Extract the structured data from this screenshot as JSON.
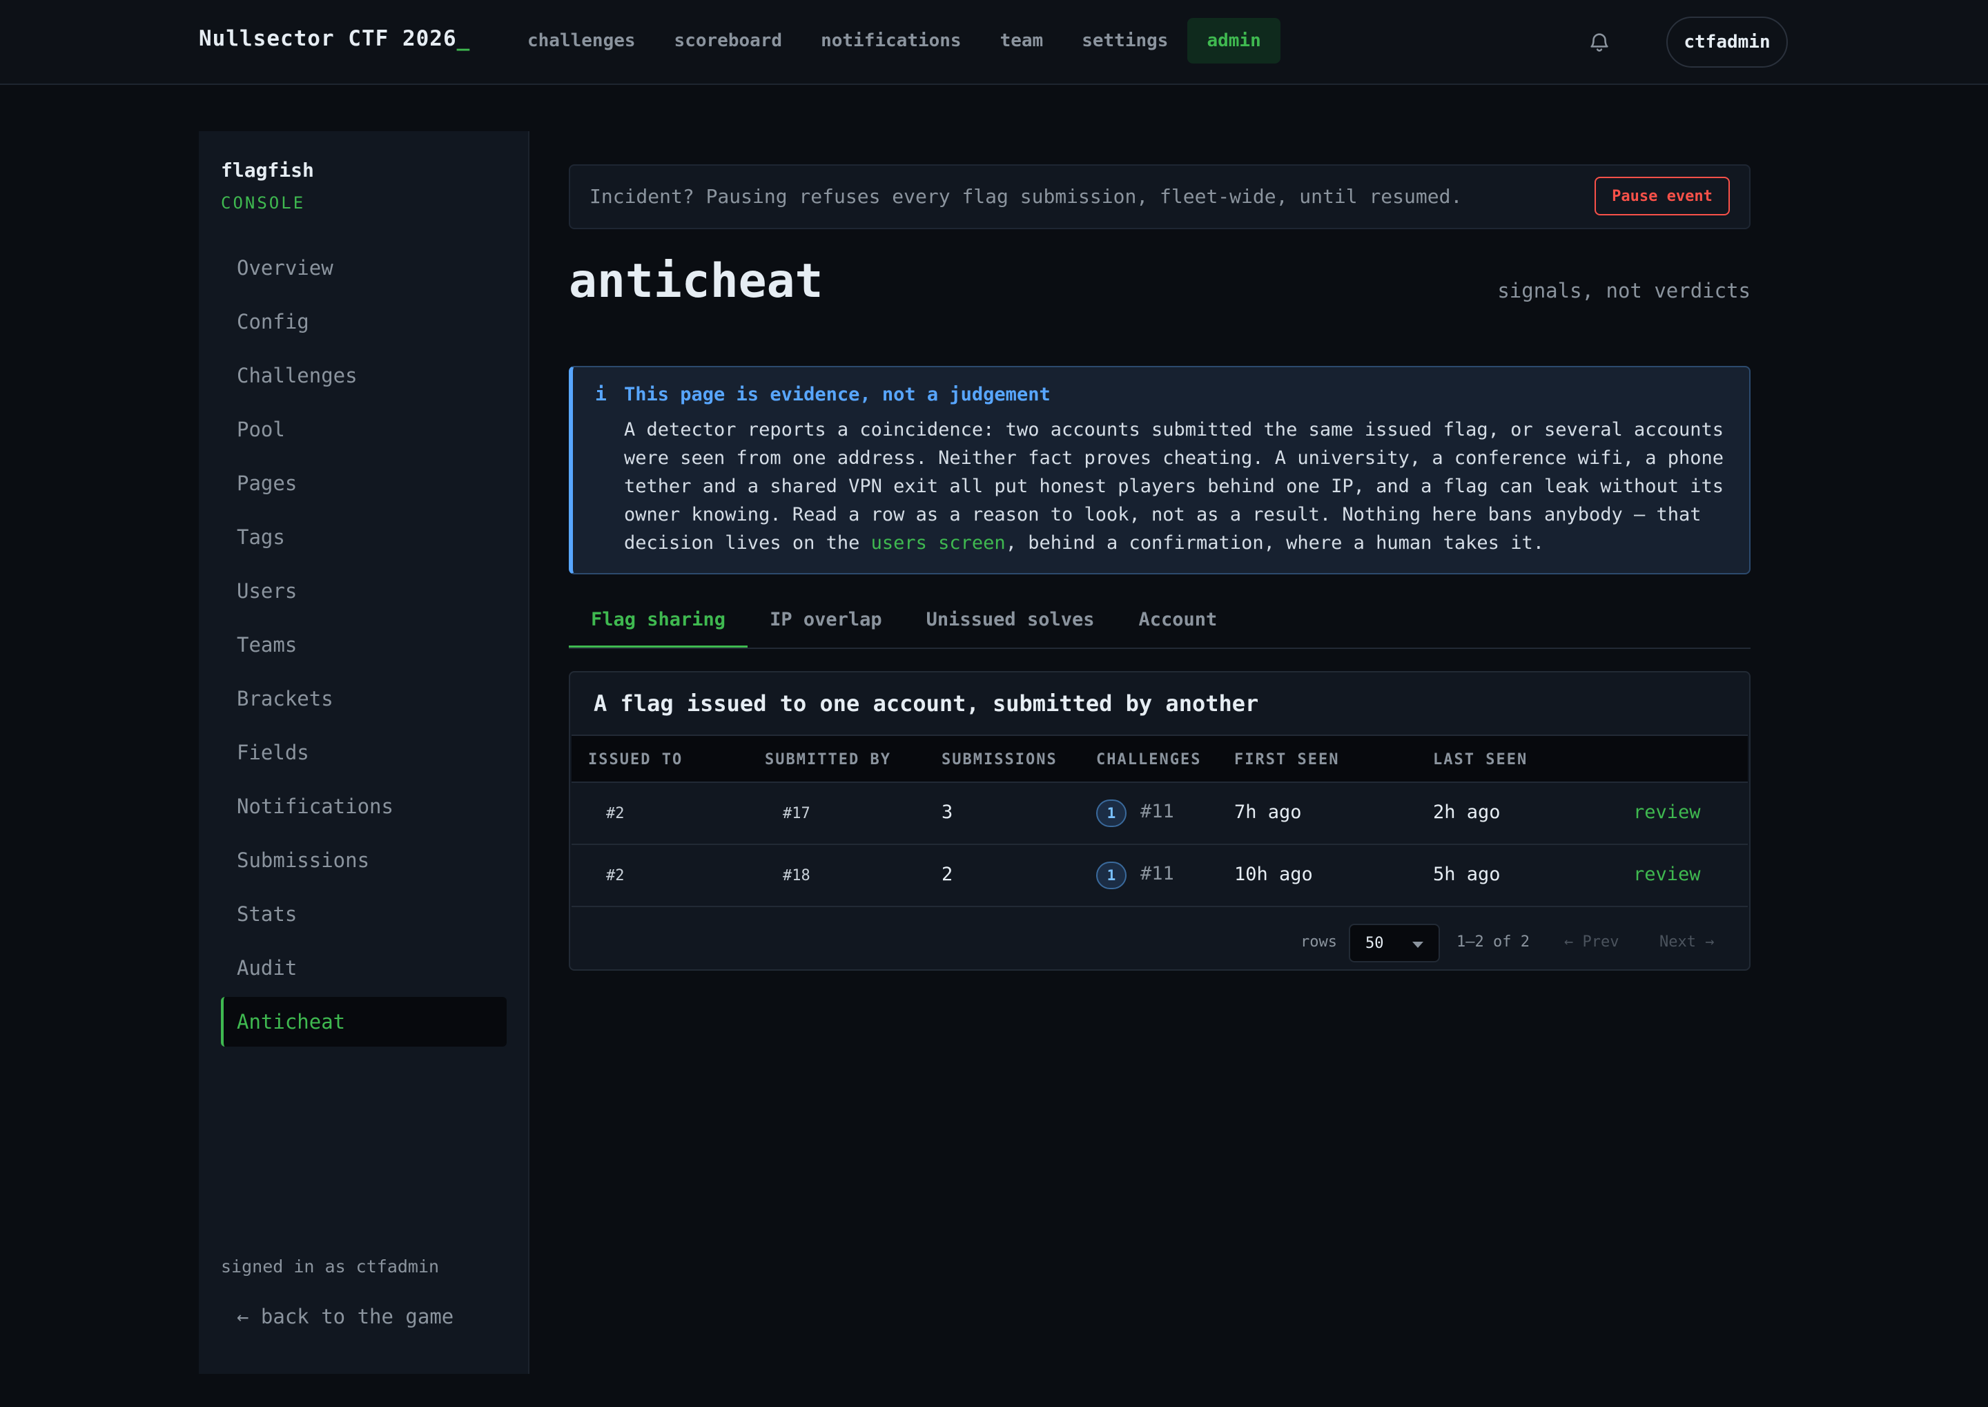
{
  "topnav": {
    "brand": "Nullsector CTF 2026",
    "brand_cursor": "_",
    "links": [
      "challenges",
      "scoreboard",
      "notifications",
      "team",
      "settings",
      "admin"
    ],
    "active_link": "admin",
    "user": "ctfadmin"
  },
  "sidebar": {
    "title": "flagfish",
    "subtitle": "CONSOLE",
    "items": [
      "Overview",
      "Config",
      "Challenges",
      "Pool",
      "Pages",
      "Tags",
      "Users",
      "Teams",
      "Brackets",
      "Fields",
      "Notifications",
      "Submissions",
      "Stats",
      "Audit",
      "Anticheat"
    ],
    "active_item": "Anticheat",
    "signed_in": "signed in as ctfadmin",
    "back_link": "← back to the game"
  },
  "banner": {
    "text": "Incident? Pausing refuses every flag submission, fleet-wide, until resumed.",
    "button": "Pause event"
  },
  "page": {
    "title": "anticheat",
    "subtitle": "signals, not verdicts"
  },
  "info": {
    "icon": "i",
    "title": "This page is evidence, not a judgement",
    "body_before": "A detector reports a coincidence: two accounts submitted the same issued flag, or several accounts were seen from one address. Neither fact proves cheating. A university, a conference wifi, a phone tether and a shared VPN exit all put honest players behind one IP, and a flag can leak without its owner knowing. Read a row as a reason to look, not as a result. Nothing here bans anybody — that decision lives on the ",
    "link": "users screen",
    "body_after": ", behind a confirmation, where a human takes it."
  },
  "tabs": [
    "Flag sharing",
    "IP overlap",
    "Unissued solves",
    "Account"
  ],
  "active_tab": "Flag sharing",
  "table": {
    "title": "A flag issued to one account, submitted by another",
    "headers": [
      "ISSUED TO",
      "SUBMITTED BY",
      "SUBMISSIONS",
      "CHALLENGES",
      "FIRST SEEN",
      "LAST SEEN"
    ],
    "rows": [
      {
        "issued_to": "#2",
        "submitted_by": "#17",
        "submissions": "3",
        "challenge_count": "1",
        "challenge": "#11",
        "first_seen": "7h ago",
        "last_seen": "2h ago",
        "action": "review"
      },
      {
        "issued_to": "#2",
        "submitted_by": "#18",
        "submissions": "2",
        "challenge_count": "1",
        "challenge": "#11",
        "first_seen": "10h ago",
        "last_seen": "5h ago",
        "action": "review"
      }
    ]
  },
  "pager": {
    "rows_label": "rows",
    "rows_value": "50",
    "count": "1–2 of 2",
    "prev": "← Prev",
    "next": "Next →"
  },
  "colors": {
    "accent": "#3fb950",
    "danger": "#f85149",
    "info": "#58a6ff",
    "background": "#0a0d12"
  },
  "icons": {
    "notifications": "bell-icon",
    "dropdown": "chevron-down-icon",
    "info": "info-icon"
  }
}
